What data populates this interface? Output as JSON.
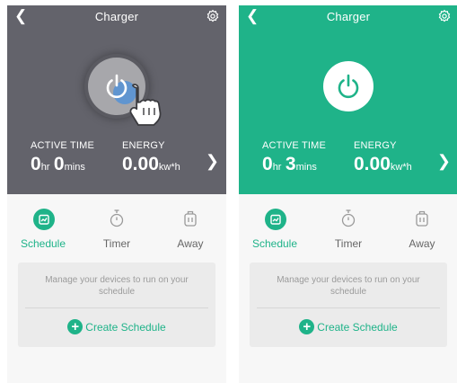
{
  "screens": [
    {
      "state": "off-pressed",
      "header": {
        "title": "Charger",
        "back_icon": "chevron-left-icon",
        "settings_icon": "gear-icon"
      },
      "power_button": {
        "icon": "power-icon"
      },
      "stats": {
        "active_time": {
          "label": "ACTIVE TIME",
          "hours": "0",
          "hours_unit": "hr",
          "mins": "0",
          "mins_unit": "mins"
        },
        "energy": {
          "label": "ENERGY",
          "value": "0.00",
          "unit": "kw*h"
        }
      },
      "tabs": [
        {
          "label": "Schedule",
          "icon": "calendar-icon",
          "active": true
        },
        {
          "label": "Timer",
          "icon": "stopwatch-icon",
          "active": false
        },
        {
          "label": "Away",
          "icon": "suitcase-icon",
          "active": false
        }
      ],
      "card": {
        "message": "Manage your devices to run on your schedule",
        "create_label": "Create Schedule"
      }
    },
    {
      "state": "on",
      "header": {
        "title": "Charger",
        "back_icon": "chevron-left-icon",
        "settings_icon": "gear-icon"
      },
      "power_button": {
        "icon": "power-icon"
      },
      "stats": {
        "active_time": {
          "label": "ACTIVE TIME",
          "hours": "0",
          "hours_unit": "hr",
          "mins": "3",
          "mins_unit": "mins"
        },
        "energy": {
          "label": "ENERGY",
          "value": "0.00",
          "unit": "kw*h"
        }
      },
      "tabs": [
        {
          "label": "Schedule",
          "icon": "calendar-icon",
          "active": true
        },
        {
          "label": "Timer",
          "icon": "stopwatch-icon",
          "active": false
        },
        {
          "label": "Away",
          "icon": "suitcase-icon",
          "active": false
        }
      ],
      "card": {
        "message": "Manage your devices to run on your schedule",
        "create_label": "Create Schedule"
      }
    }
  ],
  "colors": {
    "gray_bg": "#63636b",
    "green": "#1fb389",
    "panel_bg": "#f7f7f7",
    "card_bg": "#ebebeb"
  }
}
